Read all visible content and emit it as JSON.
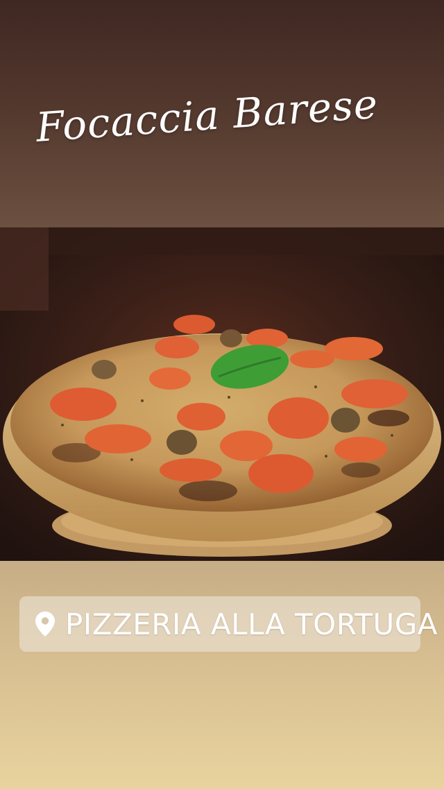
{
  "story": {
    "title": "Focaccia Barese",
    "photo": {
      "subject": "focaccia-barese-photo",
      "image_icon": "food-photo"
    },
    "location_sticker": {
      "icon": "location-pin-icon",
      "label": "PIZZERIA ALLA TORTUGA"
    },
    "colors": {
      "top_band": "#52372d",
      "bottom_band": "#d8bf92",
      "text": "#ffffff",
      "sticker_bg": "#ece4d6"
    }
  }
}
